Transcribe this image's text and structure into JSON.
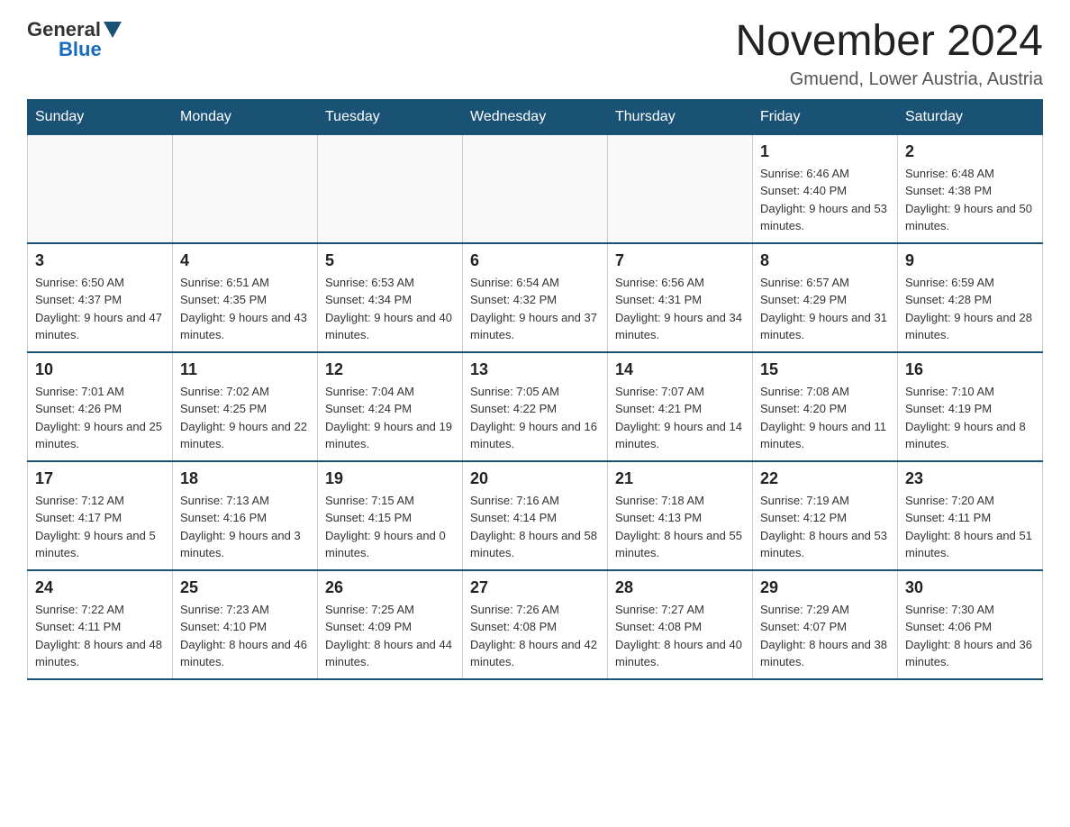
{
  "logo": {
    "general": "General",
    "blue": "Blue"
  },
  "title": "November 2024",
  "location": "Gmuend, Lower Austria, Austria",
  "weekdays": [
    "Sunday",
    "Monday",
    "Tuesday",
    "Wednesday",
    "Thursday",
    "Friday",
    "Saturday"
  ],
  "weeks": [
    [
      {
        "day": "",
        "info": ""
      },
      {
        "day": "",
        "info": ""
      },
      {
        "day": "",
        "info": ""
      },
      {
        "day": "",
        "info": ""
      },
      {
        "day": "",
        "info": ""
      },
      {
        "day": "1",
        "info": "Sunrise: 6:46 AM\nSunset: 4:40 PM\nDaylight: 9 hours and 53 minutes."
      },
      {
        "day": "2",
        "info": "Sunrise: 6:48 AM\nSunset: 4:38 PM\nDaylight: 9 hours and 50 minutes."
      }
    ],
    [
      {
        "day": "3",
        "info": "Sunrise: 6:50 AM\nSunset: 4:37 PM\nDaylight: 9 hours and 47 minutes."
      },
      {
        "day": "4",
        "info": "Sunrise: 6:51 AM\nSunset: 4:35 PM\nDaylight: 9 hours and 43 minutes."
      },
      {
        "day": "5",
        "info": "Sunrise: 6:53 AM\nSunset: 4:34 PM\nDaylight: 9 hours and 40 minutes."
      },
      {
        "day": "6",
        "info": "Sunrise: 6:54 AM\nSunset: 4:32 PM\nDaylight: 9 hours and 37 minutes."
      },
      {
        "day": "7",
        "info": "Sunrise: 6:56 AM\nSunset: 4:31 PM\nDaylight: 9 hours and 34 minutes."
      },
      {
        "day": "8",
        "info": "Sunrise: 6:57 AM\nSunset: 4:29 PM\nDaylight: 9 hours and 31 minutes."
      },
      {
        "day": "9",
        "info": "Sunrise: 6:59 AM\nSunset: 4:28 PM\nDaylight: 9 hours and 28 minutes."
      }
    ],
    [
      {
        "day": "10",
        "info": "Sunrise: 7:01 AM\nSunset: 4:26 PM\nDaylight: 9 hours and 25 minutes."
      },
      {
        "day": "11",
        "info": "Sunrise: 7:02 AM\nSunset: 4:25 PM\nDaylight: 9 hours and 22 minutes."
      },
      {
        "day": "12",
        "info": "Sunrise: 7:04 AM\nSunset: 4:24 PM\nDaylight: 9 hours and 19 minutes."
      },
      {
        "day": "13",
        "info": "Sunrise: 7:05 AM\nSunset: 4:22 PM\nDaylight: 9 hours and 16 minutes."
      },
      {
        "day": "14",
        "info": "Sunrise: 7:07 AM\nSunset: 4:21 PM\nDaylight: 9 hours and 14 minutes."
      },
      {
        "day": "15",
        "info": "Sunrise: 7:08 AM\nSunset: 4:20 PM\nDaylight: 9 hours and 11 minutes."
      },
      {
        "day": "16",
        "info": "Sunrise: 7:10 AM\nSunset: 4:19 PM\nDaylight: 9 hours and 8 minutes."
      }
    ],
    [
      {
        "day": "17",
        "info": "Sunrise: 7:12 AM\nSunset: 4:17 PM\nDaylight: 9 hours and 5 minutes."
      },
      {
        "day": "18",
        "info": "Sunrise: 7:13 AM\nSunset: 4:16 PM\nDaylight: 9 hours and 3 minutes."
      },
      {
        "day": "19",
        "info": "Sunrise: 7:15 AM\nSunset: 4:15 PM\nDaylight: 9 hours and 0 minutes."
      },
      {
        "day": "20",
        "info": "Sunrise: 7:16 AM\nSunset: 4:14 PM\nDaylight: 8 hours and 58 minutes."
      },
      {
        "day": "21",
        "info": "Sunrise: 7:18 AM\nSunset: 4:13 PM\nDaylight: 8 hours and 55 minutes."
      },
      {
        "day": "22",
        "info": "Sunrise: 7:19 AM\nSunset: 4:12 PM\nDaylight: 8 hours and 53 minutes."
      },
      {
        "day": "23",
        "info": "Sunrise: 7:20 AM\nSunset: 4:11 PM\nDaylight: 8 hours and 51 minutes."
      }
    ],
    [
      {
        "day": "24",
        "info": "Sunrise: 7:22 AM\nSunset: 4:11 PM\nDaylight: 8 hours and 48 minutes."
      },
      {
        "day": "25",
        "info": "Sunrise: 7:23 AM\nSunset: 4:10 PM\nDaylight: 8 hours and 46 minutes."
      },
      {
        "day": "26",
        "info": "Sunrise: 7:25 AM\nSunset: 4:09 PM\nDaylight: 8 hours and 44 minutes."
      },
      {
        "day": "27",
        "info": "Sunrise: 7:26 AM\nSunset: 4:08 PM\nDaylight: 8 hours and 42 minutes."
      },
      {
        "day": "28",
        "info": "Sunrise: 7:27 AM\nSunset: 4:08 PM\nDaylight: 8 hours and 40 minutes."
      },
      {
        "day": "29",
        "info": "Sunrise: 7:29 AM\nSunset: 4:07 PM\nDaylight: 8 hours and 38 minutes."
      },
      {
        "day": "30",
        "info": "Sunrise: 7:30 AM\nSunset: 4:06 PM\nDaylight: 8 hours and 36 minutes."
      }
    ]
  ]
}
